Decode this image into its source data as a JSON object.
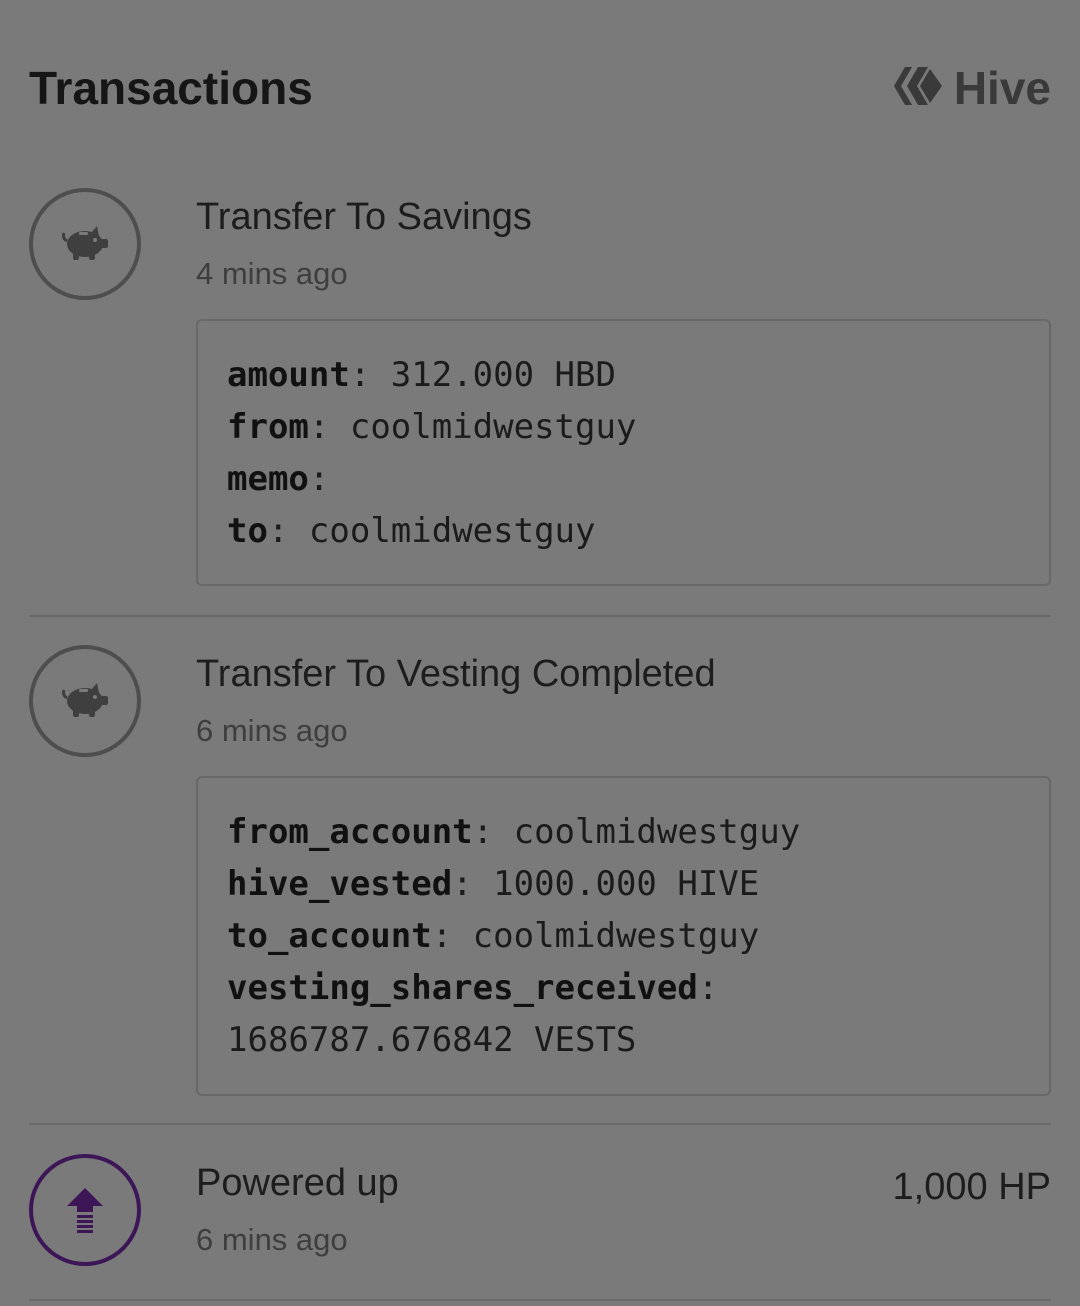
{
  "header": {
    "title": "Transactions",
    "brand_name": "Hive",
    "brand_icon": "hive-logo-icon"
  },
  "transactions": [
    {
      "icon": "piggy-bank-icon",
      "title": "Transfer To Savings",
      "time": "4 mins ago",
      "details": [
        {
          "key": "amount",
          "value": "312.000 HBD"
        },
        {
          "key": "from",
          "value": "coolmidwestguy"
        },
        {
          "key": "memo",
          "value": ""
        },
        {
          "key": "to",
          "value": "coolmidwestguy"
        }
      ]
    },
    {
      "icon": "piggy-bank-icon",
      "title": "Transfer To Vesting Completed",
      "time": "6 mins ago",
      "details": [
        {
          "key": "from_account",
          "value": "coolmidwestguy"
        },
        {
          "key": "hive_vested",
          "value": "1000.000 HIVE"
        },
        {
          "key": "to_account",
          "value": "coolmidwestguy"
        },
        {
          "key": "vesting_shares_received",
          "value": "1686787.676842 VESTS"
        }
      ]
    },
    {
      "icon": "power-up-arrow-icon",
      "title": "Powered up",
      "time": "6 mins ago",
      "amount": "1,000 HP"
    }
  ],
  "colors": {
    "overlay_background": "#7a7a7a",
    "power_up_accent": "#3c1657"
  }
}
